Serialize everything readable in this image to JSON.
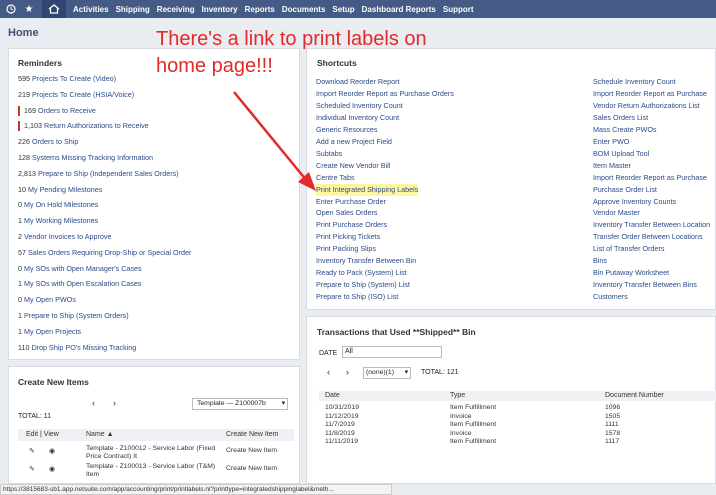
{
  "nav": [
    "Activities",
    "Shipping",
    "Receiving",
    "Inventory",
    "Reports",
    "Documents",
    "Setup",
    "Dashboard Reports",
    "Support"
  ],
  "page_title": "Home",
  "annotation": {
    "line1": "There's a link to print labels on",
    "line2": "home page!!!"
  },
  "reminders": {
    "title": "Reminders",
    "items": [
      {
        "count": "595",
        "label": "Projects To Create (Video)",
        "flag": false
      },
      {
        "count": "219",
        "label": "Projects To Create (HSIA/Voice)",
        "flag": false
      },
      {
        "count": "169",
        "label": "Orders to Receive",
        "flag": true
      },
      {
        "count": "1,103",
        "label": "Return Authorizations to Receive",
        "flag": true
      },
      {
        "count": "226",
        "label": "Orders to Ship",
        "flag": false
      },
      {
        "count": "128",
        "label": "Systems Missing Tracking Information",
        "flag": false
      },
      {
        "count": "2,813",
        "label": "Prepare to Ship (Independent Sales Orders)",
        "flag": false
      },
      {
        "count": "10",
        "label": "My Pending Milestones",
        "flag": false
      },
      {
        "count": "0",
        "label": "My On Hold Milestones",
        "flag": false
      },
      {
        "count": "1",
        "label": "My Working Milestones",
        "flag": false
      },
      {
        "count": "2",
        "label": "Vendor Invoices to Approve",
        "flag": false
      },
      {
        "count": "57",
        "label": "Sales Orders Requiring Drop-Ship or Special Order",
        "flag": false
      },
      {
        "count": "0",
        "label": "My SOs with Open Manager's Cases",
        "flag": false
      },
      {
        "count": "1",
        "label": "My SOs with Open Escalation Cases",
        "flag": false
      },
      {
        "count": "0",
        "label": "My Open PWOs",
        "flag": false
      },
      {
        "count": "1",
        "label": "Prepare to Ship (System Orders)",
        "flag": false
      },
      {
        "count": "1",
        "label": "My Open Projects",
        "flag": false
      },
      {
        "count": "110",
        "label": "Drop Ship PO's Missing Tracking",
        "flag": false
      }
    ]
  },
  "create_items": {
    "title": "Create New Items",
    "template_select": "Template — Z100007b",
    "total": "TOTAL: 11",
    "headers": [
      "Edit | View",
      "Name ▲",
      "Create New Item"
    ],
    "rows": [
      {
        "name": "Template - Z100012 - Service Labor (Fixed Price Contract) It",
        "action": "Create New Item"
      },
      {
        "name": "Template - Z100013 - Service Labor (T&M) Item",
        "action": "Create New Item"
      }
    ]
  },
  "shortcuts": {
    "title": "Shortcuts",
    "left": [
      "Download Reorder Report",
      "Import Reorder Report as Purchase Orders",
      "Scheduled Inventory Count",
      "Individual Inventory Count",
      "Generic Resources",
      "Add a new Project Field",
      "Subtabs",
      "Create New Vendor Bill",
      "Centre Tabs",
      "Print Integrated Shipping Labels",
      "Enter Purchase Order",
      "Open Sales Orders",
      "Print Purchase Orders",
      "Print Picking Tickets",
      "Print Packing Slips",
      "Inventory Transfer Between Bin",
      "Ready to Pack (System) List",
      "Prepare to Ship (System) List",
      "Prepare to Ship (ISO) List"
    ],
    "right": [
      "Schedule Inventory Count",
      "Import Reorder Report as Purchase",
      "Vendor Return Authorizations List",
      "Sales Orders List",
      "Mass Create PWOs",
      "Enter PWO",
      "BOM Upload Tool",
      "Item Master",
      "Import Reorder Report as Purchase",
      "Purchase Order List",
      "Approve Inventory Counts",
      "Vendor Master",
      "Inventory Transfer Between Location",
      "Transfer Order Between Locations",
      "List of Transfer Orders",
      "Bins",
      "Bin Putaway Worksheet",
      "Inventory Transfer Between Bins",
      "Customers"
    ],
    "highlight_index": 9
  },
  "transactions": {
    "title": "Transactions that Used **Shipped** Bin",
    "date_label": "DATE",
    "date_value": "All",
    "pager": "(none)(1)",
    "total": "TOTAL: 121",
    "headers": [
      "Date",
      "Type",
      "Document Number"
    ],
    "rows": [
      [
        "10/31/2019",
        "Item Fulfillment",
        "1096"
      ],
      [
        "11/12/2019",
        "Invoice",
        "1505"
      ],
      [
        "11/7/2019",
        "Item Fulfillment",
        "1111"
      ],
      [
        "11/8/2019",
        "Invoice",
        "1578"
      ],
      [
        "11/11/2019",
        "Item Fulfillment",
        "1117"
      ]
    ]
  },
  "status_url": "https://3815683-sb1.app.netsuite.com/app/accounting/print/printlabels.nl?printtype=integratedshippinglabel&meth..."
}
